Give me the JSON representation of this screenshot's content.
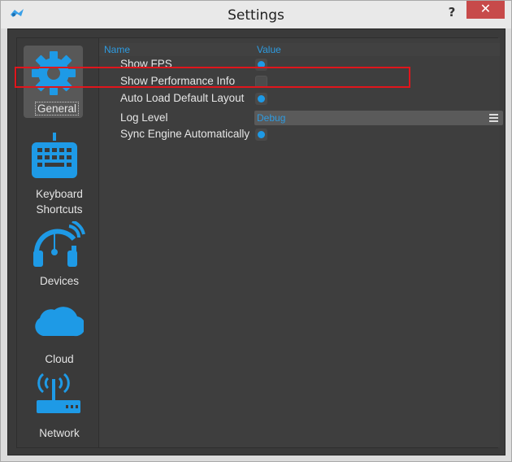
{
  "window": {
    "title": "Settings",
    "help_label": "?",
    "close_label": "✕"
  },
  "sidebar": {
    "items": [
      {
        "label": "General",
        "icon": "gear-icon",
        "active": true
      },
      {
        "label": "Keyboard Shortcuts",
        "icon": "keyboard-icon",
        "active": false
      },
      {
        "label": "Devices",
        "icon": "headphones-icon",
        "active": false
      },
      {
        "label": "Cloud",
        "icon": "cloud-icon",
        "active": false
      },
      {
        "label": "Network",
        "icon": "router-icon",
        "active": false
      }
    ]
  },
  "table": {
    "headers": {
      "name": "Name",
      "value": "Value"
    },
    "rows": [
      {
        "label": "Show FPS",
        "type": "toggle",
        "enabled": true
      },
      {
        "label": "Show Performance Info",
        "type": "toggle",
        "enabled": false
      },
      {
        "label": "Auto Load Default Layout",
        "type": "toggle",
        "enabled": true
      },
      {
        "label": "Log Level",
        "type": "dropdown",
        "value": "Debug"
      },
      {
        "label": "Sync Engine Automatically",
        "type": "toggle",
        "enabled": true
      }
    ]
  },
  "colors": {
    "accent": "#1e9ae6",
    "highlight": "#e0151c",
    "panel_bg": "#3e3e3e"
  }
}
